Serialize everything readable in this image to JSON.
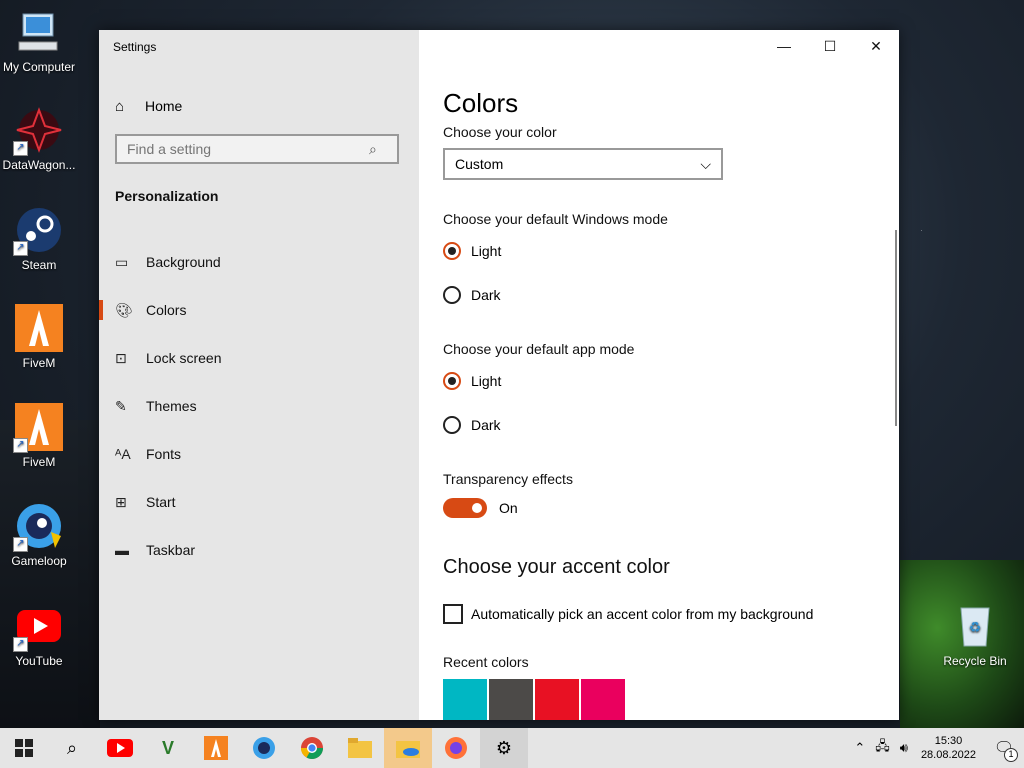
{
  "desktop": {
    "icons": [
      {
        "label": "My Computer",
        "icon": "computer-icon"
      },
      {
        "label": "DataWagon...",
        "icon": "datawagon-icon"
      },
      {
        "label": "Steam",
        "icon": "steam-icon"
      },
      {
        "label": "FiveM",
        "icon": "fivem-icon"
      },
      {
        "label": "FiveM",
        "icon": "fivem-icon"
      },
      {
        "label": "Gameloop",
        "icon": "gameloop-icon"
      },
      {
        "label": "YouTube",
        "icon": "youtube-icon"
      },
      {
        "label": "Recycle Bin",
        "icon": "recycle-bin-icon"
      }
    ]
  },
  "window": {
    "title": "Settings",
    "controls": {
      "minimize": "—",
      "maximize": "☐",
      "close": "✕"
    }
  },
  "sidebar": {
    "home_label": "Home",
    "search_placeholder": "Find a setting",
    "section": "Personalization",
    "items": [
      {
        "label": "Background",
        "icon": "picture-icon"
      },
      {
        "label": "Colors",
        "icon": "palette-icon",
        "active": true
      },
      {
        "label": "Lock screen",
        "icon": "lock-screen-icon"
      },
      {
        "label": "Themes",
        "icon": "themes-icon"
      },
      {
        "label": "Fonts",
        "icon": "fonts-icon"
      },
      {
        "label": "Start",
        "icon": "start-icon"
      },
      {
        "label": "Taskbar",
        "icon": "taskbar-icon"
      }
    ]
  },
  "content": {
    "title": "Colors",
    "choose_color_label": "Choose your color",
    "choose_color_value": "Custom",
    "windows_mode_label": "Choose your default Windows mode",
    "windows_mode_options": [
      "Light",
      "Dark"
    ],
    "windows_mode_selected": "Light",
    "app_mode_label": "Choose your default app mode",
    "app_mode_options": [
      "Light",
      "Dark"
    ],
    "app_mode_selected": "Light",
    "transparency_label": "Transparency effects",
    "transparency_state": "On",
    "accent_heading": "Choose your accent color",
    "auto_accent_label": "Automatically pick an accent color from my background",
    "auto_accent_checked": false,
    "recent_colors_label": "Recent colors",
    "recent_colors": [
      "#00b7c3",
      "#4c4a48",
      "#e81123",
      "#ea005e"
    ],
    "accent_color": "#d74a14"
  },
  "taskbar": {
    "apps": [
      "start-icon",
      "search-icon",
      "youtube-icon",
      "gta-icon",
      "fivem-icon",
      "gameloop-icon",
      "chrome-icon",
      "file-explorer-icon",
      "onedrive-folder-icon",
      "firefox-icon",
      "settings-icon"
    ],
    "time": "15:30",
    "date": "28.08.2022",
    "notification_count": "1"
  }
}
